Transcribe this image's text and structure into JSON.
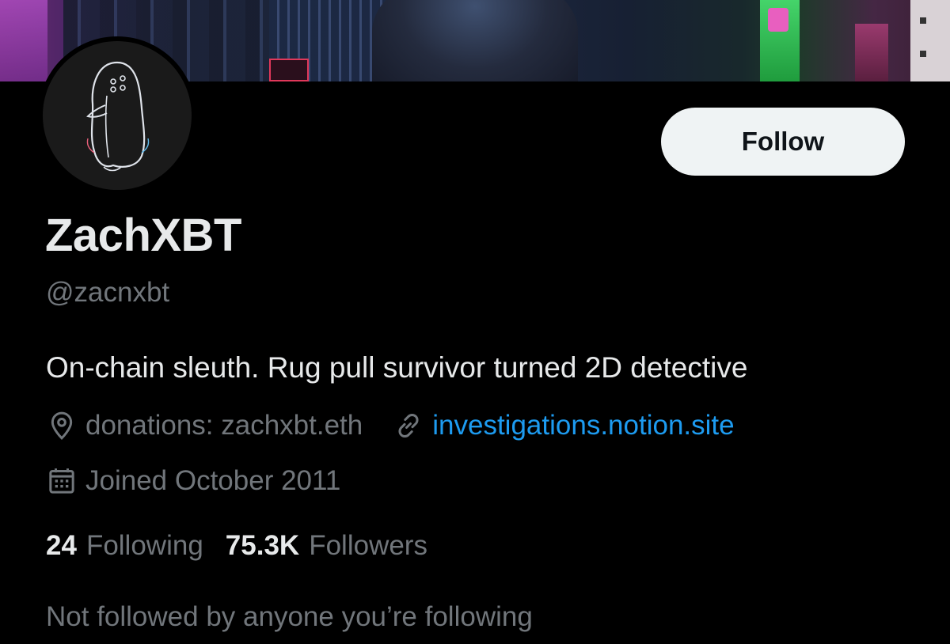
{
  "profile": {
    "display_name": "ZachXBT",
    "handle": "@zacnxbt",
    "bio": "On-chain sleuth. Rug pull survivor turned 2D detective",
    "location": "donations: zachxbt.eth",
    "website": "investigations.notion.site",
    "joined": "Joined October 2011",
    "following_count": "24",
    "following_label": "Following",
    "followers_count": "75.3K",
    "followers_label": "Followers",
    "mutuals_text": "Not followed by anyone you’re following"
  },
  "actions": {
    "follow_label": "Follow"
  },
  "icons": {
    "location": "location-pin-icon",
    "link": "link-icon",
    "joined": "calendar-icon",
    "avatar": "penguin-icon"
  },
  "colors": {
    "background": "#000000",
    "text_primary": "#e7e9ea",
    "text_secondary": "#71767b",
    "link": "#1d9bf0",
    "button_bg": "#eff3f4",
    "button_text": "#0f1419"
  }
}
